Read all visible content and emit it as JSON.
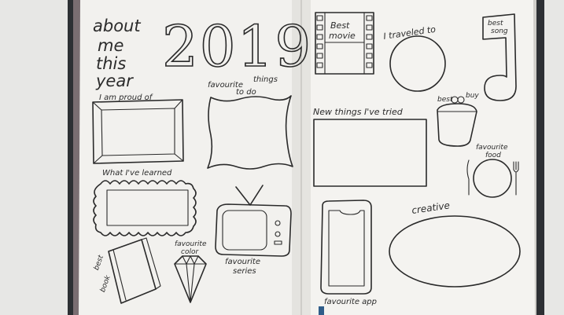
{
  "journal": {
    "left_page": {
      "heading_lines": [
        "about",
        "me",
        "this",
        "year"
      ],
      "year": "2019",
      "proud_label": "I am proud of",
      "things_label": [
        "favourite",
        "things",
        "to do"
      ],
      "learned_label": "What I've learned",
      "book_label": [
        "best",
        "book"
      ],
      "color_label": [
        "favourite",
        "color"
      ],
      "series_label": [
        "favourite",
        "series"
      ]
    },
    "right_page": {
      "movie_label": [
        "Best",
        "movie"
      ],
      "traveled_label": "I traveled to",
      "song_label": [
        "best",
        "song"
      ],
      "tried_label": "New things I've tried",
      "buy_label": [
        "best",
        "buy"
      ],
      "food_label": [
        "favourite",
        "food"
      ],
      "creative_label": "creative",
      "app_label": "favourite app"
    }
  },
  "colors": {
    "background": "#e6e6e4",
    "paper": "#f3f2ef",
    "cover": "#2c2f33",
    "ink": "#2a2a2a",
    "ribbon": "#2f5d8a"
  },
  "icons": [
    "film-strip-icon",
    "music-note-icon",
    "coin-purse-icon",
    "plate-fork-knife-icon",
    "tv-icon",
    "book-icon",
    "diamond-icon",
    "phone-icon"
  ]
}
